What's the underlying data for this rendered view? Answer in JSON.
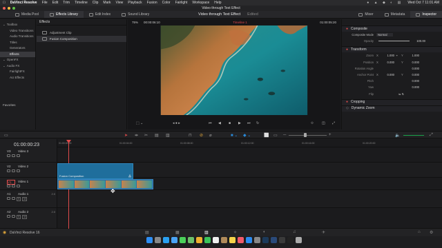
{
  "menubar": {
    "app": "DaVinci Resolve",
    "items": [
      "File",
      "Edit",
      "Trim",
      "Timeline",
      "Clip",
      "Mark",
      "View",
      "Playback",
      "Fusion",
      "Color",
      "Fairlight",
      "Workspace",
      "Help"
    ],
    "clock": "Wed Oct 7  11:01 AM"
  },
  "window": {
    "title": "Video through Text Effect"
  },
  "toolbar": {
    "media_pool": "Media Pool",
    "effects_library": "Effects Library",
    "edit_index": "Edit Index",
    "sound_library": "Sound Library",
    "project_name": "Video through Text Effect",
    "project_status": "Edited",
    "mixer": "Mixer",
    "metadata": "Metadata",
    "inspector": "Inspector"
  },
  "media_tree": {
    "items": [
      {
        "label": "Toolbox",
        "sub": false,
        "sel": false
      },
      {
        "label": "Video Transitions",
        "sub": true,
        "sel": false
      },
      {
        "label": "Audio Transitions",
        "sub": true,
        "sel": false
      },
      {
        "label": "Titles",
        "sub": true,
        "sel": false
      },
      {
        "label": "Generators",
        "sub": true,
        "sel": false
      },
      {
        "label": "Effects",
        "sub": true,
        "sel": true
      },
      {
        "label": "OpenFX",
        "sub": false,
        "sel": false
      },
      {
        "label": "Audio FX",
        "sub": false,
        "sel": false
      },
      {
        "label": "FairlightFX",
        "sub": true,
        "sel": false
      },
      {
        "label": "AU Effects",
        "sub": true,
        "sel": false
      }
    ],
    "favorites": "Favorites"
  },
  "effects": {
    "header": "Effects",
    "items": [
      {
        "label": "Adjustment Clip",
        "sel": false
      },
      {
        "label": "Fusion Composition",
        "sel": true
      }
    ]
  },
  "viewer": {
    "zoom": "75%",
    "source_tc": "00:00:06:10",
    "timeline_name": "Timeline 1",
    "record_tc": "01:00:05:20"
  },
  "inspector": {
    "composite": {
      "title": "Composite",
      "mode_label": "Composite Mode",
      "mode_value": "Normal",
      "opacity_label": "Opacity",
      "opacity_value": "100.00"
    },
    "transform": {
      "title": "Transform",
      "rows": [
        {
          "label": "Zoom",
          "x_tag": "X",
          "x": "1.000",
          "y_tag": "Y",
          "y": "1.000"
        },
        {
          "label": "Position",
          "x_tag": "X",
          "x": "0.000",
          "y_tag": "Y",
          "y": "0.000"
        },
        {
          "label": "Rotation Angle",
          "x_tag": "",
          "x": "",
          "y_tag": "",
          "y": "0.000"
        },
        {
          "label": "Anchor Point",
          "x_tag": "X",
          "x": "0.000",
          "y_tag": "Y",
          "y": "0.000"
        },
        {
          "label": "Pitch",
          "x_tag": "",
          "x": "",
          "y_tag": "",
          "y": "0.000"
        },
        {
          "label": "Yaw",
          "x_tag": "",
          "x": "",
          "y_tag": "",
          "y": "0.000"
        },
        {
          "label": "Flip",
          "x_tag": "",
          "x": "",
          "y_tag": "",
          "y": ""
        }
      ]
    },
    "cropping": "Cropping",
    "dynamic_zoom": "Dynamic Zoom"
  },
  "timeline": {
    "timecode": "01:00:00:23",
    "ruler": [
      "01:00:00:00",
      "01:00:04:00",
      "01:00:08:00",
      "01:00:12:00",
      "01:00:16:00",
      "01:00:20:00"
    ],
    "tracks": [
      {
        "id": "V3",
        "name": "Video 3"
      },
      {
        "id": "V2",
        "name": "Video 2"
      },
      {
        "id": "V1",
        "name": "Video 1"
      },
      {
        "id": "A1",
        "name": "Audio 1",
        "ch": "2.0"
      },
      {
        "id": "A2",
        "name": "Audio 2",
        "ch": "2.0"
      }
    ],
    "fusion_clip_label": "Fusion Composition"
  },
  "footer": {
    "app_name": "DaVinci Resolve 16"
  },
  "colors": {
    "accent": "#2a8ad8",
    "timeline_name": "#e0444b",
    "fusion_clip": "#1f6e9c",
    "video_clip": "#2c6fa3"
  }
}
